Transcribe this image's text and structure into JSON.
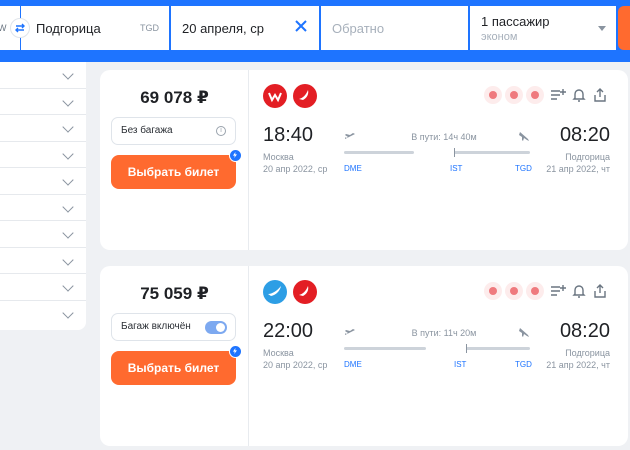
{
  "search": {
    "from_edge": "W",
    "to_city": "Подгорица",
    "to_iata": "TGD",
    "date": "20 апреля, ср",
    "return_placeholder": "Обратно",
    "passengers": "1 пассажир",
    "cabin_class": "эконом"
  },
  "sidebar": {
    "rows": 10
  },
  "colors": {
    "accent": "#1e74ff",
    "buy": "#ff6a2f",
    "airline_red": "#e31e24"
  },
  "tickets": [
    {
      "price": "69 078 ₽",
      "baggage": "Без багажа",
      "buy_label": "Выбрать билет",
      "dep_time": "18:40",
      "dep_city": "Москва",
      "dep_date": "20 апр 2022, ср",
      "arr_time": "08:20",
      "arr_city": "Подгорица",
      "arr_date": "21 апр 2022, чт",
      "duration": "В пути: 14ч 40м",
      "codes": {
        "dep": "DME",
        "stop": "IST",
        "arr": "TGD"
      },
      "icons": [
        "wizz-air-logo",
        "turkish-airlines-logo"
      ]
    },
    {
      "price": "75 059 ₽",
      "baggage": "Багаж включён",
      "buy_label": "Выбрать билет",
      "dep_time": "22:00",
      "dep_city": "Москва",
      "dep_date": "20 апр 2022, ср",
      "arr_time": "08:20",
      "arr_city": "Подгорица",
      "arr_date": "21 апр 2022, чт",
      "duration": "В пути: 11ч 20м",
      "codes": {
        "dep": "DME",
        "stop": "IST",
        "arr": "TGD"
      },
      "icons": [
        "ajet-logo",
        "turkish-airlines-logo"
      ]
    }
  ]
}
